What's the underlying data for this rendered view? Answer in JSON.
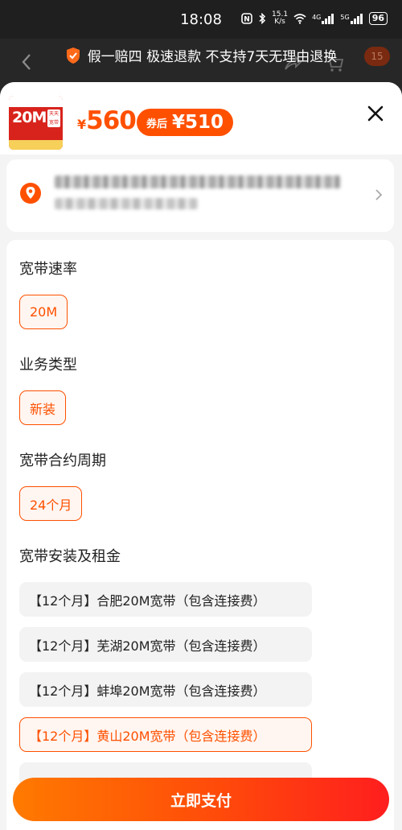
{
  "status_bar": {
    "time": "18:08",
    "net_speed_value": "15.1",
    "net_speed_unit": "K/s",
    "signal1_label": "4G",
    "signal2_label": "5G",
    "battery": "96"
  },
  "background_page": {
    "cart_badge": "15"
  },
  "notice": {
    "text": "假一赔四 极速退款 不支持7天无理由退换"
  },
  "product": {
    "thumb_badge": "20M",
    "thumb_side_text": "天天宽带",
    "price_symbol": "¥",
    "price": "560",
    "coupon_label": "券后",
    "coupon_price": "¥510"
  },
  "sections": {
    "speed": {
      "title": "宽带速率",
      "option": "20M"
    },
    "type": {
      "title": "业务类型",
      "option": "新装"
    },
    "contract": {
      "title": "宽带合约周期",
      "option": "24个月"
    },
    "install": {
      "title": "宽带安装及租金",
      "options": [
        "【12个月】合肥20M宽带（包含连接费）",
        "【12个月】芜湖20M宽带（包含连接费）",
        "【12个月】蚌埠20M宽带（包含连接费）",
        "【12个月】黄山20M宽带（包含连接费）"
      ],
      "selected_index": 3
    }
  },
  "footer": {
    "pay_label": "立即支付"
  },
  "colors": {
    "accent": "#ff5000",
    "sheet_bg": "#f4f4f4"
  }
}
